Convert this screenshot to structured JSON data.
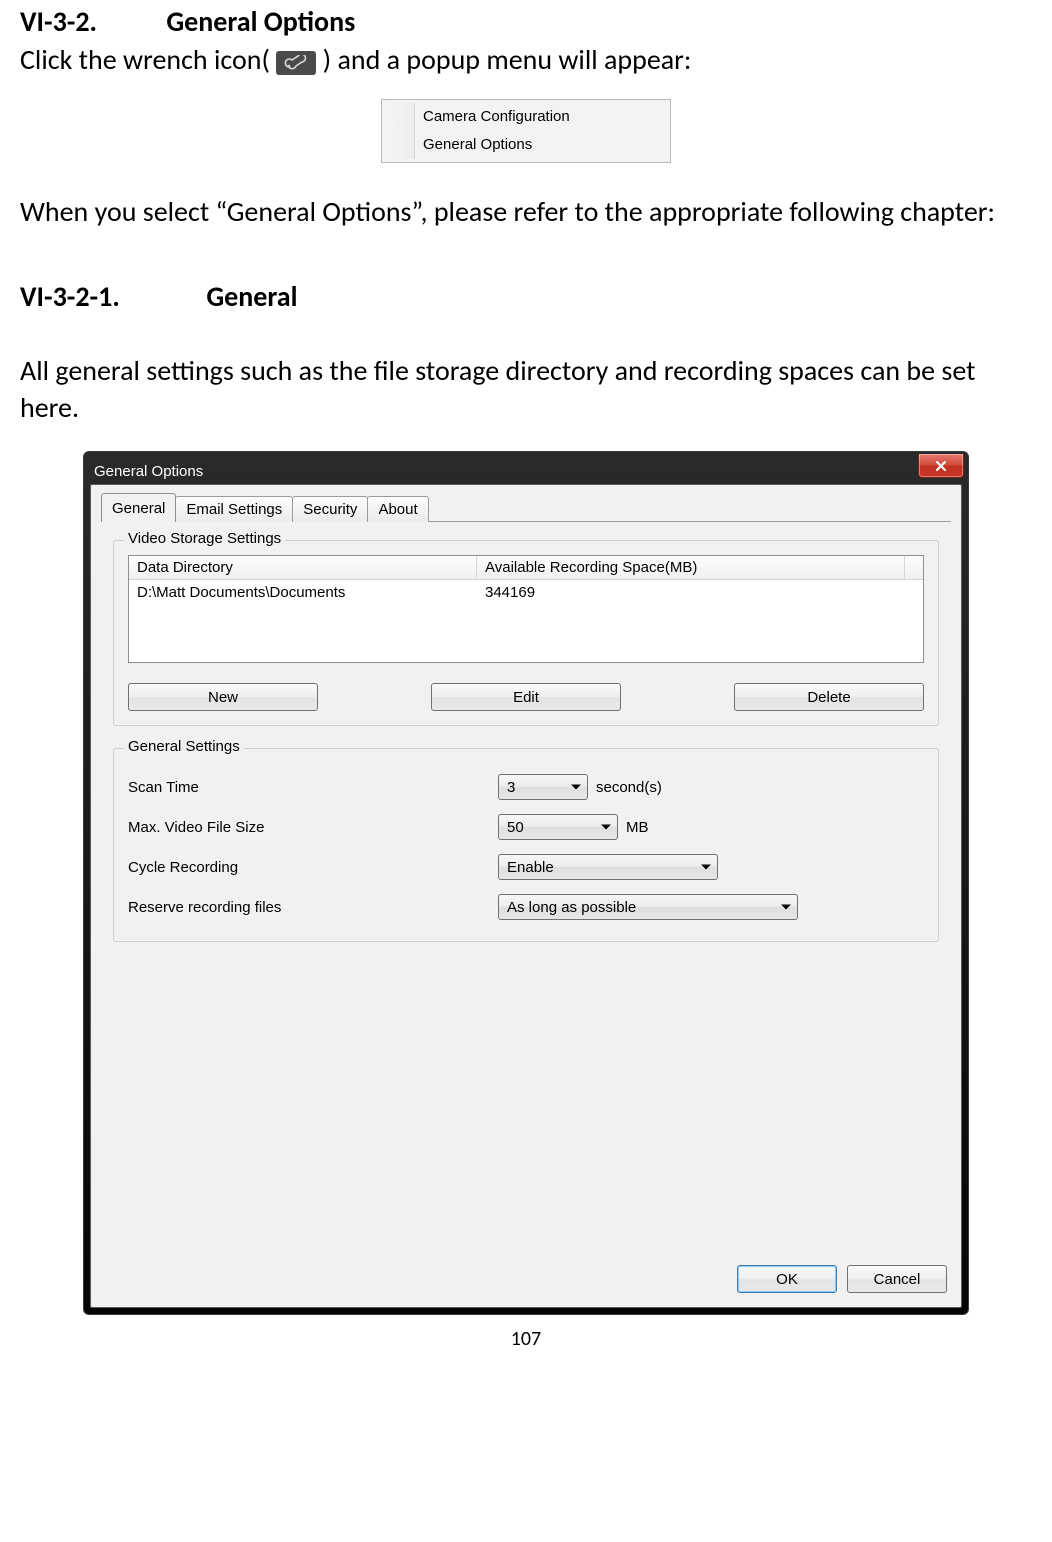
{
  "doc": {
    "heading1_num": "VI-3-2.",
    "heading1_title": "General Options",
    "line1_pre": "Click the wrench icon(",
    "line1_post": ") and a popup menu will appear:",
    "popup": {
      "item1": "Camera Configuration",
      "item2": "General Options"
    },
    "para_after_popup": "When you select “General Options”, please refer to the appropriate following chapter:",
    "heading2_num": "VI-3-2-1.",
    "heading2_title": "General",
    "para_before_dialog": "All general settings such as the file storage directory and recording spaces can be set here.",
    "page_number": "107"
  },
  "dialog": {
    "title": "General Options",
    "tabs": {
      "general": "General",
      "email": "Email Settings",
      "security": "Security",
      "about": "About"
    },
    "storage": {
      "group_title": "Video Storage Settings",
      "col_data_dir": "Data Directory",
      "col_space": "Available Recording Space(MB)",
      "row1_dir": "D:\\Matt Documents\\Documents",
      "row1_space": "344169",
      "btn_new": "New",
      "btn_edit": "Edit",
      "btn_delete": "Delete"
    },
    "general": {
      "group_title": "General Settings",
      "scan_label": "Scan Time",
      "scan_value": "3",
      "scan_unit": "second(s)",
      "maxsize_label": "Max. Video File Size",
      "maxsize_value": "50",
      "maxsize_unit": "MB",
      "cycle_label": "Cycle Recording",
      "cycle_value": "Enable",
      "reserve_label": "Reserve recording files",
      "reserve_value": "As long as possible"
    },
    "footer": {
      "ok": "OK",
      "cancel": "Cancel"
    }
  }
}
